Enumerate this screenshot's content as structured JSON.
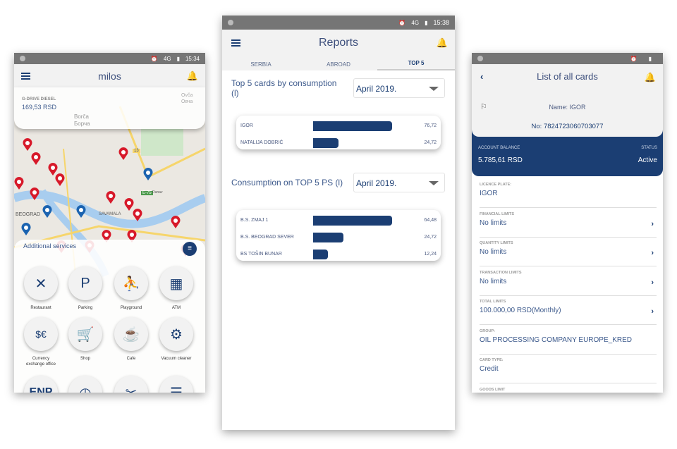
{
  "left": {
    "status": {
      "time": "15:34",
      "network": "4G"
    },
    "title": "milos",
    "fuel": {
      "label": "G-DRIVE DIESEL",
      "price": "169,53 RSD"
    },
    "map_labels": [
      "Borča",
      "Борча",
      "Ovča",
      "Овча",
      "13",
      "E-75",
      "BEOGRAD",
      "SAVAMALA",
      "Dunav"
    ],
    "services_title": "Additional services",
    "services": [
      {
        "label": "Restaurant",
        "icon": "restaurant-icon"
      },
      {
        "label": "Parking",
        "icon": "parking-icon"
      },
      {
        "label": "Playground",
        "icon": "playground-icon"
      },
      {
        "label": "ATM",
        "icon": "atm-icon"
      },
      {
        "label": "Currency exchange office",
        "icon": "currency-exchange-icon"
      },
      {
        "label": "Shop",
        "icon": "shop-cart-icon"
      },
      {
        "label": "Cafe",
        "icon": "cafe-icon"
      },
      {
        "label": "Vacuum cleaner",
        "icon": "vacuum-cleaner-icon"
      }
    ],
    "partial_service": "ENP"
  },
  "middle": {
    "status": {
      "time": "15:38",
      "network": "4G"
    },
    "title": "Reports",
    "tabs": [
      {
        "label": "SERBIA"
      },
      {
        "label": "ABROAD"
      },
      {
        "label": "TOP 5",
        "active": true
      }
    ],
    "section1": {
      "title": "Top 5 cards by consumption (l)",
      "period": "April 2019.",
      "rows": [
        {
          "name": "IGOR",
          "value": 76.72,
          "label": "76,72"
        },
        {
          "name": "NATALIJA DOBRIĆ",
          "value": 24.72,
          "label": "24,72"
        }
      ]
    },
    "section2": {
      "title": "Consumption on TOP 5 PS (l)",
      "period": "April 2019.",
      "rows": [
        {
          "name": "B.S. ZMAJ 1",
          "value": 64.48,
          "label": "64,48"
        },
        {
          "name": "B.S. BEOGRAD SEVER",
          "value": 24.72,
          "label": "24,72"
        },
        {
          "name": "BS TOŠIN BUNAR",
          "value": 12.24,
          "label": "12,24"
        }
      ]
    }
  },
  "right": {
    "status": "Active",
    "title": "List of all cards",
    "name": "Name: IGOR",
    "number": "No: 7824723060703077",
    "balance_label": "ACCOUNT BALANCE",
    "balance": "5.785,61 RSD",
    "status_label": "STATUS",
    "fields": [
      {
        "key": "LICENCE PLATE:",
        "value": "IGOR",
        "link": false
      },
      {
        "key": "FINANCIAL LIMITS",
        "value": "No limits",
        "link": true
      },
      {
        "key": "QUANTITY LIMITS",
        "value": "No limits",
        "link": true
      },
      {
        "key": "TRANSACTION LIMITS",
        "value": "No limits",
        "link": true
      },
      {
        "key": "TOTAL LIMITS",
        "value": "100.000,00 RSD(Monthly)",
        "link": true
      },
      {
        "key": "GROUP:",
        "value": "OIL PROCESSING COMPANY EUROPE_KRED",
        "link": false
      },
      {
        "key": "CARD TYPE:",
        "value": "Credit",
        "link": false
      },
      {
        "key": "GOODS LIMIT",
        "value": "",
        "link": false
      }
    ]
  },
  "colors": {
    "primary": "#1b3e73",
    "pin": "#d7192a",
    "statusbar": "#757575"
  }
}
